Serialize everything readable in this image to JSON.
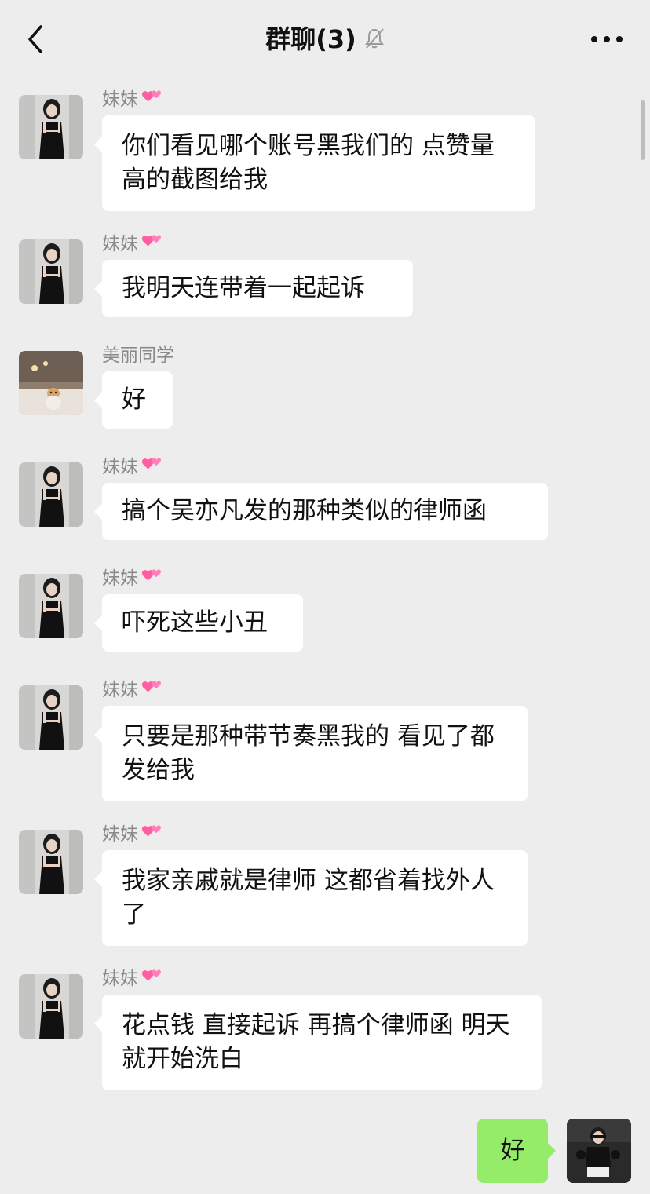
{
  "header": {
    "title": "群聊(3)",
    "icons": [
      "back-arrow-icon",
      "mute-bell-icon",
      "more-dots-icon"
    ]
  },
  "messages": [
    {
      "sender": "妹妹",
      "avatar": "woman-black-dress-avatar",
      "text": "你们看见哪个账号黑我们的  点赞量高的截图给我"
    },
    {
      "sender": "妹妹",
      "avatar": "woman-black-dress-avatar",
      "text": "我明天连带着一起起诉"
    },
    {
      "sender": "美丽同学",
      "avatar": "room-with-dog-avatar",
      "text": "好"
    },
    {
      "sender": "妹妹",
      "avatar": "woman-black-dress-avatar",
      "text": "搞个吴亦凡发的那种类似的律师函"
    },
    {
      "sender": "妹妹",
      "avatar": "woman-black-dress-avatar",
      "text": "吓死这些小丑"
    },
    {
      "sender": "妹妹",
      "avatar": "woman-black-dress-avatar",
      "text": "只要是那种带节奏黑我的 看见了都发给我"
    },
    {
      "sender": "妹妹",
      "avatar": "woman-black-dress-avatar",
      "text": "我家亲戚就是律师 这都省着找外人了"
    },
    {
      "sender": "妹妹",
      "avatar": "woman-black-dress-avatar",
      "text": "花点钱 直接起诉 再搞个律师函 明天就开始洗白"
    }
  ],
  "self_message": {
    "text": "好",
    "avatar": "woman-selfie-avatar"
  },
  "colors": {
    "background": "#ededed",
    "bubble_other": "#ffffff",
    "bubble_self": "#95ec69",
    "sender_name": "#8a8a8a",
    "heart": "#ff5fa2"
  }
}
